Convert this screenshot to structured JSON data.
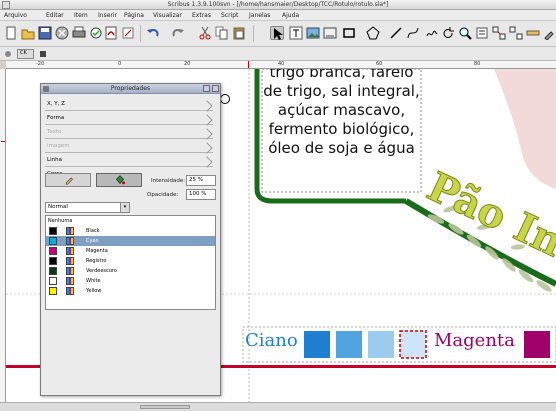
{
  "window": {
    "title": "Scribus 1.3.9.100svn - [/home/hansmaier/Desktop/TCC/Rotulo/rotulo.sla*]"
  },
  "menu": [
    "Arquivo",
    "Editar",
    "Item",
    "Inserir",
    "Página",
    "Visualizar",
    "Extras",
    "Script",
    "Janelas",
    "Ajuda"
  ],
  "toolbar2": {
    "mode_label": "CK",
    "mode_icon": "color-mode-icon"
  },
  "rulers": {
    "labels": [
      "-20",
      "0",
      "20",
      "40",
      "60",
      "80"
    ]
  },
  "document": {
    "ingredients_lines": [
      "trigo branca, farelo",
      "de trigo, sal integral,",
      "açúcar mascavo,",
      "fermento biológico,",
      "óleo de soja e água"
    ],
    "brand_text": "Pão Int",
    "swatch_labels": {
      "cyan": "Ciano",
      "magenta": "Magenta"
    },
    "colors": {
      "frame_green": "#1a6b1a",
      "logo_text": "#c8d44c",
      "cyan_strong": "#1f7fd0",
      "cyan_mid": "#52a4e0",
      "cyan_light": "#9ccbee",
      "cyan_faint": "#cfe4f6",
      "magenta": "#a0006a",
      "rule_red": "#c0002a"
    }
  },
  "properties_panel": {
    "title": "Propriedades",
    "sections": [
      "X, Y, Z",
      "Forma",
      "Texto",
      "Imagem",
      "Linha",
      "Cores"
    ],
    "color_tabs": {
      "stroke_icon": "pen-icon",
      "fill_icon": "fill-bucket-icon"
    },
    "intensity": {
      "label": "Intensidade:",
      "value": "25 %"
    },
    "opacity": {
      "label": "Opacidade:",
      "value": "100 %"
    },
    "blend_mode": "Normal",
    "colors": [
      {
        "name": "Nenhuma",
        "swatch": ""
      },
      {
        "name": "Black",
        "swatch": "#000000"
      },
      {
        "name": "Cyan",
        "swatch": "#00aee8",
        "selected": true
      },
      {
        "name": "Magenta",
        "swatch": "#c8007a"
      },
      {
        "name": "Registro",
        "swatch": "#000000"
      },
      {
        "name": "Verdeescuro",
        "swatch": "#0a3d12"
      },
      {
        "name": "White",
        "swatch": "#ffffff"
      },
      {
        "name": "Yellow",
        "swatch": "#fff200"
      }
    ]
  }
}
